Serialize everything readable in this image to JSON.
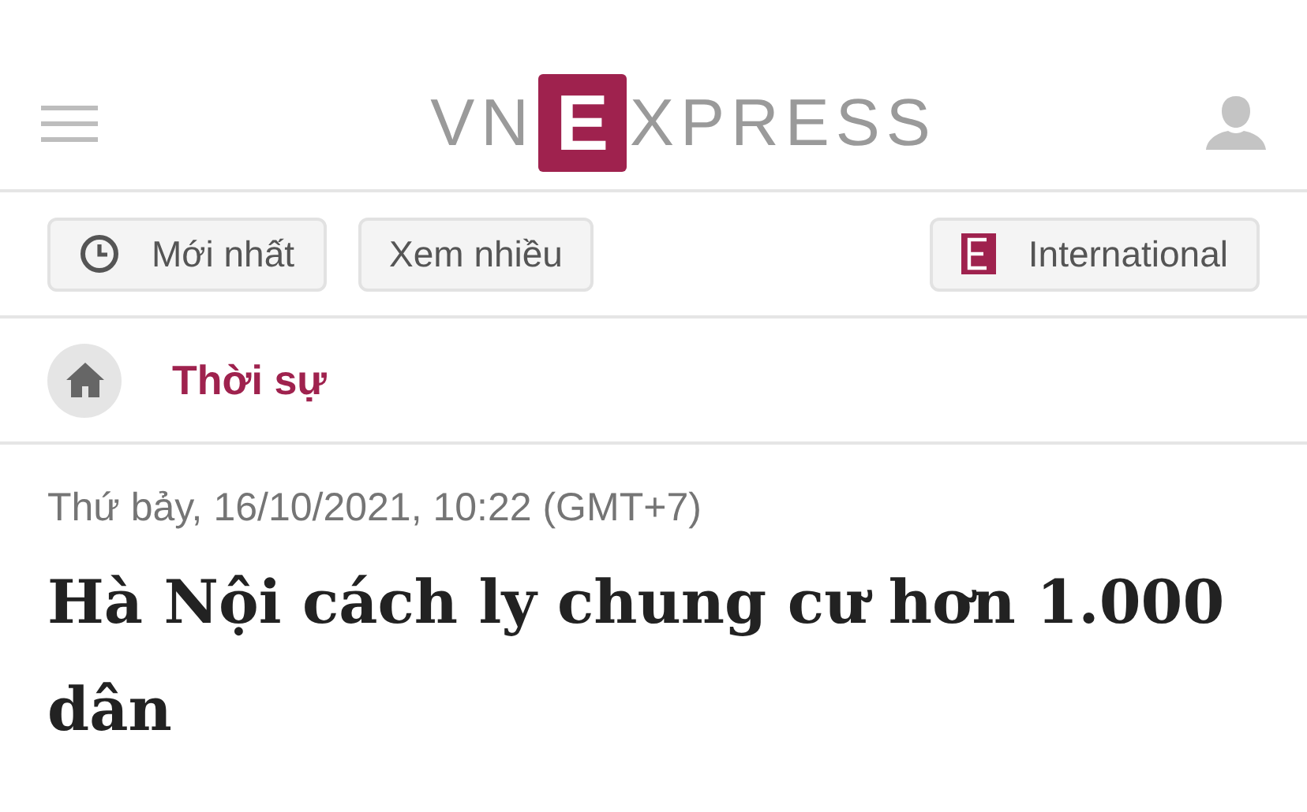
{
  "logo": {
    "left": "VN",
    "mark": "E",
    "right": "XPRESS"
  },
  "nav_buttons": [
    {
      "kind": "clock",
      "label": "Mới nhất"
    },
    {
      "kind": "plain",
      "label": "Xem nhiều"
    },
    {
      "kind": "edition",
      "label": "International"
    }
  ],
  "breadcrumb": {
    "category": "Thời sự"
  },
  "article": {
    "date": "Thứ bảy, 16/10/2021, 10:22 (GMT+7)",
    "title": "Hà Nội cách ly chung cư hơn 1.000 dân"
  }
}
